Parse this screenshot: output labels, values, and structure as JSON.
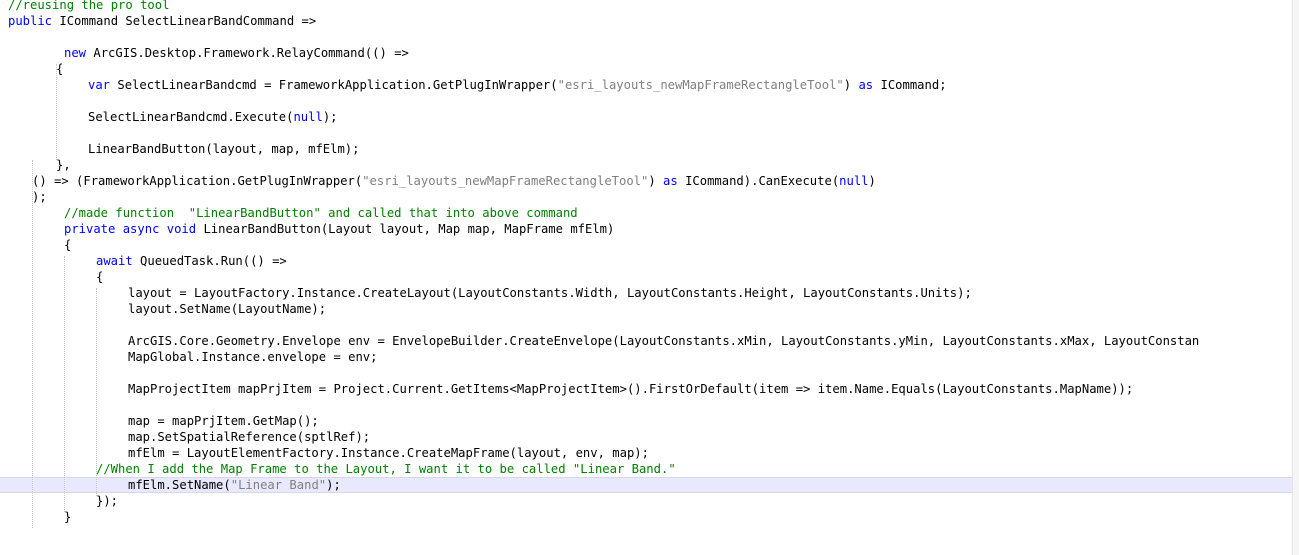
{
  "editor": {
    "lines": [
      {
        "indent": 8,
        "tokens": [
          {
            "t": "//reusing the pro tool",
            "c": "cm"
          }
        ]
      },
      {
        "indent": 8,
        "tokens": [
          {
            "t": "public",
            "c": "kw"
          },
          {
            "t": " ICommand SelectLinearBandCommand =>"
          }
        ]
      },
      {
        "indent": 0,
        "tokens": []
      },
      {
        "indent": 64,
        "tokens": [
          {
            "t": "new",
            "c": "kw"
          },
          {
            "t": " ArcGIS.Desktop.Framework.RelayCommand(() =>"
          }
        ]
      },
      {
        "indent": 56,
        "tokens": [
          {
            "t": "{"
          }
        ]
      },
      {
        "indent": 88,
        "tokens": [
          {
            "t": "var",
            "c": "kw"
          },
          {
            "t": " SelectLinearBandcmd = FrameworkApplication.GetPlugInWrapper("
          },
          {
            "t": "\"esri_layouts_newMapFrameRectangleTool\"",
            "c": "st"
          },
          {
            "t": ") "
          },
          {
            "t": "as",
            "c": "kw"
          },
          {
            "t": " ICommand;"
          }
        ]
      },
      {
        "indent": 0,
        "tokens": []
      },
      {
        "indent": 88,
        "tokens": [
          {
            "t": "SelectLinearBandcmd.Execute("
          },
          {
            "t": "null",
            "c": "kw"
          },
          {
            "t": ");"
          }
        ]
      },
      {
        "indent": 0,
        "tokens": []
      },
      {
        "indent": 88,
        "tokens": [
          {
            "t": "LinearBandButton(layout, map, mfElm);"
          }
        ]
      },
      {
        "indent": 56,
        "tokens": [
          {
            "t": "},"
          }
        ]
      },
      {
        "indent": 32,
        "tokens": [
          {
            "t": "() => (FrameworkApplication.GetPlugInWrapper("
          },
          {
            "t": "\"esri_layouts_newMapFrameRectangleTool\"",
            "c": "st"
          },
          {
            "t": ") "
          },
          {
            "t": "as",
            "c": "kw"
          },
          {
            "t": " ICommand).CanExecute("
          },
          {
            "t": "null",
            "c": "kw"
          },
          {
            "t": ")"
          }
        ]
      },
      {
        "indent": 32,
        "tokens": [
          {
            "t": ");"
          }
        ]
      },
      {
        "indent": 64,
        "tokens": [
          {
            "t": "//made function  \"LinearBandButton\" and called that into above command",
            "c": "cm"
          }
        ]
      },
      {
        "indent": 64,
        "tokens": [
          {
            "t": "private",
            "c": "kw"
          },
          {
            "t": " "
          },
          {
            "t": "async",
            "c": "kw"
          },
          {
            "t": " "
          },
          {
            "t": "void",
            "c": "kw"
          },
          {
            "t": " LinearBandButton(Layout layout, Map map, MapFrame mfElm)"
          }
        ]
      },
      {
        "indent": 64,
        "tokens": [
          {
            "t": "{"
          }
        ]
      },
      {
        "indent": 96,
        "tokens": [
          {
            "t": "await",
            "c": "kw"
          },
          {
            "t": " QueuedTask.Run(() =>"
          }
        ]
      },
      {
        "indent": 96,
        "tokens": [
          {
            "t": "{"
          }
        ]
      },
      {
        "indent": 128,
        "tokens": [
          {
            "t": "layout = LayoutFactory.Instance.CreateLayout(LayoutConstants.Width, LayoutConstants.Height, LayoutConstants.Units);"
          }
        ]
      },
      {
        "indent": 128,
        "tokens": [
          {
            "t": "layout.SetName(LayoutName);"
          }
        ]
      },
      {
        "indent": 0,
        "tokens": []
      },
      {
        "indent": 128,
        "tokens": [
          {
            "t": "ArcGIS.Core.Geometry.Envelope env = EnvelopeBuilder.CreateEnvelope(LayoutConstants.xMin, LayoutConstants.yMin, LayoutConstants.xMax, LayoutConstan"
          }
        ]
      },
      {
        "indent": 128,
        "tokens": [
          {
            "t": "MapGlobal.Instance.envelope = env;"
          }
        ]
      },
      {
        "indent": 0,
        "tokens": []
      },
      {
        "indent": 128,
        "tokens": [
          {
            "t": "MapProjectItem mapPrjItem = Project.Current.GetItems<MapProjectItem>().FirstOrDefault(item => item.Name.Equals(LayoutConstants.MapName));"
          }
        ]
      },
      {
        "indent": 0,
        "tokens": []
      },
      {
        "indent": 128,
        "tokens": [
          {
            "t": "map = mapPrjItem.GetMap();"
          }
        ]
      },
      {
        "indent": 128,
        "tokens": [
          {
            "t": "map.SetSpatialReference(sptlRef);"
          }
        ]
      },
      {
        "indent": 128,
        "tokens": [
          {
            "t": "mfElm = LayoutElementFactory.Instance.CreateMapFrame(layout, env, map);"
          }
        ]
      },
      {
        "indent": 96,
        "tokens": [
          {
            "t": "//When I add the Map Frame to the Layout, I want it to be called \"Linear Band.\"",
            "c": "cm"
          }
        ]
      },
      {
        "indent": 128,
        "tokens": [
          {
            "t": "mfElm.SetName("
          },
          {
            "t": "\"Linear Band\"",
            "c": "st"
          },
          {
            "t": ");"
          }
        ]
      },
      {
        "indent": 96,
        "tokens": [
          {
            "t": "});"
          }
        ]
      },
      {
        "indent": 64,
        "tokens": [
          {
            "t": "}"
          }
        ]
      }
    ]
  }
}
